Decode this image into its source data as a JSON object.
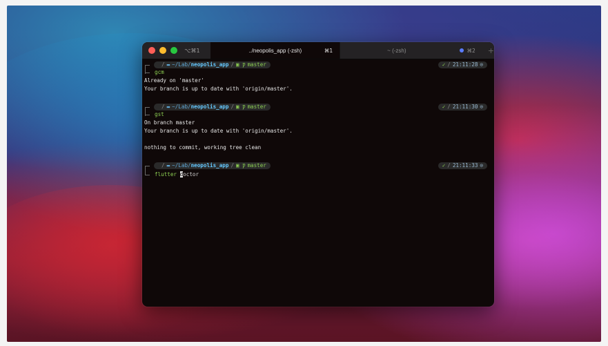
{
  "window": {
    "tab_shortcut_left": "⌥⌘1",
    "tabs": [
      {
        "label": "../neopolis_app (-zsh)",
        "shortcut": "⌘1",
        "active": true
      },
      {
        "label": "~ (-zsh)",
        "shortcut": "",
        "active": false
      }
    ],
    "tab_shortcut_right": "⌘2",
    "new_tab": "+"
  },
  "prompt": {
    "apple": "",
    "slash": "/",
    "folder_icon": "folder-icon",
    "path_prefix": "~/Lab/",
    "path_dir": "neopolis_app",
    "branch_icon": "git-branch-icon",
    "branch": "master",
    "check": "✓"
  },
  "blocks": [
    {
      "time": "21:11:28",
      "command": "gcm",
      "output": [
        "Already on 'master'",
        "Your branch is up to date with 'origin/master'."
      ]
    },
    {
      "time": "21:11:30",
      "command": "gst",
      "output": [
        "On branch master",
        "Your branch is up to date with 'origin/master'.",
        "",
        "nothing to commit, working tree clean"
      ]
    },
    {
      "time": "21:11:33",
      "command_main": "flutter",
      "command_cursor": "d",
      "command_rest": "octor"
    }
  ],
  "colors": {
    "branch_green": "#8ed053",
    "path_blue": "#64c8ff",
    "terminal_bg": "#0f0808"
  }
}
